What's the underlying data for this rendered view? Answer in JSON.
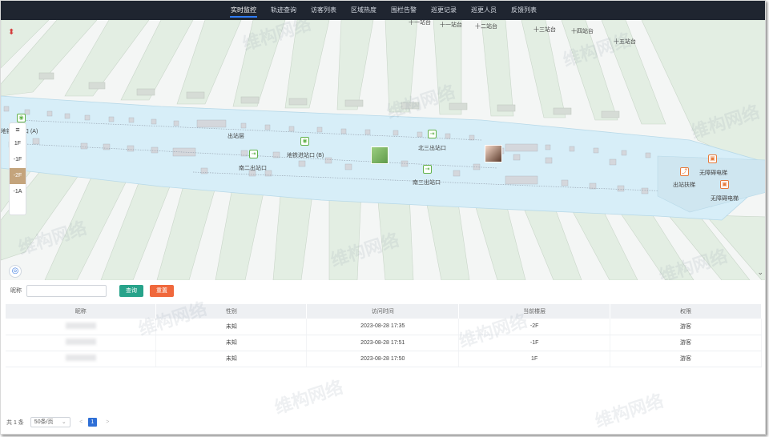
{
  "nav": {
    "tabs": [
      {
        "label": "实时监控",
        "active": true
      },
      {
        "label": "轨迹查询",
        "active": false
      },
      {
        "label": "访客列表",
        "active": false
      },
      {
        "label": "区域热度",
        "active": false
      },
      {
        "label": "围栏告警",
        "active": false
      },
      {
        "label": "巡更记录",
        "active": false
      },
      {
        "label": "巡更人员",
        "active": false
      },
      {
        "label": "反馈列表",
        "active": false
      }
    ]
  },
  "map": {
    "floors": [
      "1F",
      "-1F",
      "-2F",
      "-1A"
    ],
    "active_floor": "-2F",
    "labels": {
      "stop_11": "十一站台",
      "stop_12": "十二站台",
      "stop_13": "十三站台",
      "stop_14": "十四站台",
      "stop_15": "十五站台",
      "subway_a": "地铁进站口 (A)",
      "exit_layer": "出站层",
      "subway_b": "地铁进站口 (B)",
      "south2": "南二出站口",
      "north3": "北三出站口",
      "south3": "南三出站口",
      "escalator": "出站扶梯",
      "barrier_free_1": "无障碍电梯",
      "barrier_free_2": "无障碍电梯"
    },
    "watermark": "维构网络",
    "colors": {
      "corridor": "#d7eef8",
      "block": "#cfd6d0",
      "green_strip": "#e2ede1"
    }
  },
  "search": {
    "label": "昵称",
    "placeholder": "",
    "value": "",
    "query_label": "查询",
    "reset_label": "重置"
  },
  "table": {
    "headers": [
      "昵称",
      "性别",
      "访问时间",
      "当前楼层",
      "权限"
    ],
    "rows": [
      {
        "gender": "未知",
        "time": "2023-08-28 17:35",
        "floor": "-2F",
        "role": "游客"
      },
      {
        "gender": "未知",
        "time": "2023-08-28 17:51",
        "floor": "-1F",
        "role": "游客"
      },
      {
        "gender": "未知",
        "time": "2023-08-28 17:50",
        "floor": "1F",
        "role": "游客"
      }
    ]
  },
  "pager": {
    "total": "共 1 条",
    "page_size": "50条/页",
    "prev": "<",
    "next": ">",
    "current": "1"
  }
}
